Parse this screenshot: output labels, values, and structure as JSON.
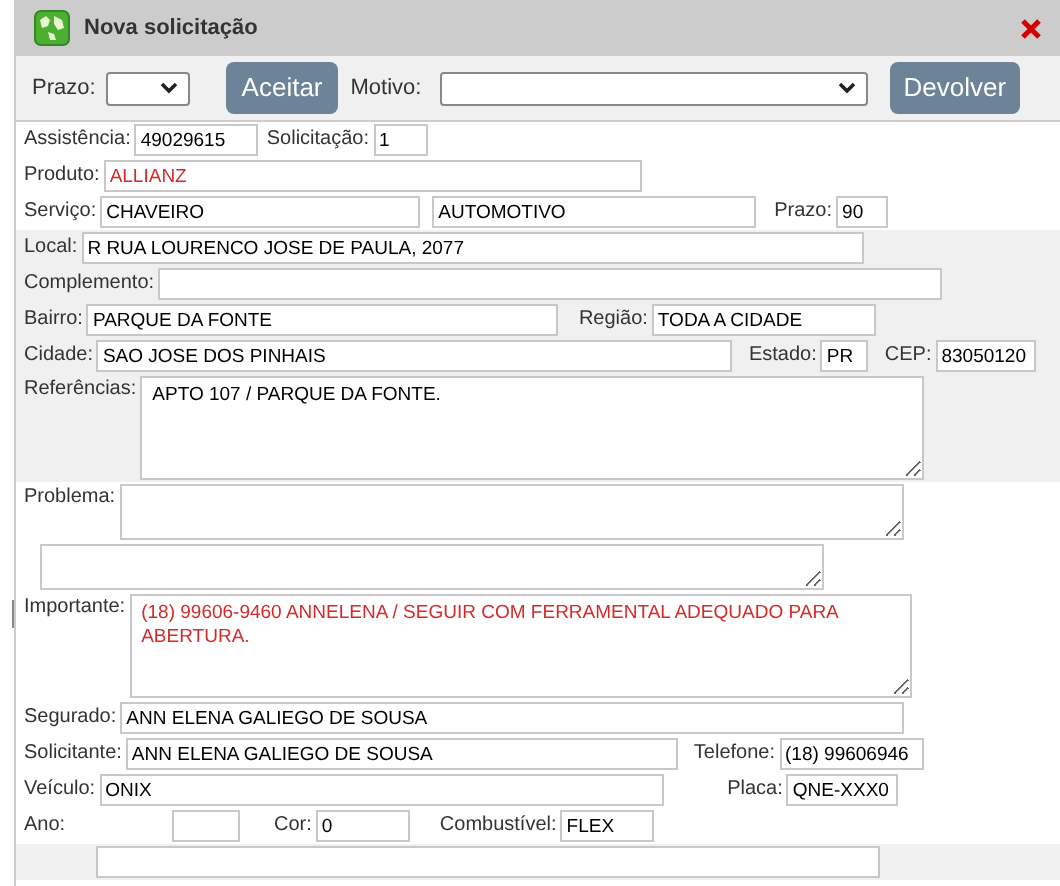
{
  "window": {
    "title": "Nova solicitação"
  },
  "toolbar": {
    "prazo_label": "Prazo:",
    "accept_button": "Aceitar",
    "motivo_label": "Motivo:",
    "return_button": "Devolver"
  },
  "rows": [
    {
      "items": [
        {
          "kind": "field",
          "label": "Assistência:",
          "value": "49029615"
        },
        {
          "kind": "field",
          "label": "Solicitação:",
          "value": "1"
        }
      ]
    },
    {
      "items": [
        {
          "kind": "field",
          "label": "Produto:",
          "value": "ALLIANZ",
          "color": "#d42a2a"
        }
      ]
    },
    {
      "items": [
        {
          "kind": "field",
          "label": "Serviço:",
          "value": "CHAVEIRO"
        },
        {
          "kind": "field",
          "value": "AUTOMOTIVO"
        },
        {
          "kind": "field",
          "label": "Prazo:",
          "value": "90"
        }
      ]
    },
    {
      "items": [
        {
          "kind": "field",
          "label": "Local:",
          "value": "R RUA LOURENCO JOSE DE PAULA, 2077"
        }
      ]
    },
    {
      "items": [
        {
          "kind": "field",
          "label": "Complemento:"
        }
      ]
    },
    {
      "items": [
        {
          "kind": "field",
          "label": "Bairro:",
          "value": "PARQUE DA FONTE"
        },
        {
          "kind": "field",
          "label": "Região:",
          "value": "TODA A CIDADE"
        }
      ]
    },
    {
      "items": [
        {
          "kind": "field",
          "label": "Cidade:",
          "value": "SAO JOSE DOS PINHAIS"
        },
        {
          "kind": "field",
          "label": "Estado:",
          "value": "PR"
        },
        {
          "kind": "field",
          "label": "CEP:",
          "value": "83050120"
        }
      ]
    },
    {
      "items": [
        {
          "kind": "textarea",
          "label": "Referências:",
          "value": "APTO 107 / PARQUE DA FONTE."
        }
      ]
    },
    {
      "items": [
        {
          "kind": "textarea",
          "label": "Problema:"
        }
      ]
    },
    {
      "items": [
        {
          "kind": "textarea"
        }
      ]
    },
    {
      "items": [
        {
          "kind": "textarea",
          "label": "Importante:",
          "value": "(18) 99606-9460 ANNELENA / SEGUIR COM FERRAMENTAL ADEQUADO PARA ABERTURA.",
          "color": "#d42a2a"
        }
      ]
    },
    {
      "items": [
        {
          "kind": "field",
          "label": "Segurado:",
          "value": "ANN ELENA GALIEGO DE SOUSA"
        }
      ]
    },
    {
      "items": [
        {
          "kind": "field",
          "label": "Solicitante:",
          "value": "ANN ELENA GALIEGO DE SOUSA"
        },
        {
          "kind": "field",
          "label": "Telefone:",
          "value": "(18) 99606946"
        }
      ]
    },
    {
      "items": [
        {
          "kind": "field",
          "label": "Veículo:",
          "value": "ONIX"
        },
        {
          "kind": "field",
          "label": "Placa:",
          "value": "QNE-XXX0"
        }
      ]
    },
    {
      "items": [
        {
          "kind": "field",
          "label": "Ano:"
        },
        {
          "kind": "field",
          "label": "Cor:",
          "value": "0"
        },
        {
          "kind": "field",
          "label": "Combustível:",
          "value": "FLEX"
        }
      ]
    },
    {
      "items": [
        {
          "kind": "field"
        }
      ]
    }
  ]
}
